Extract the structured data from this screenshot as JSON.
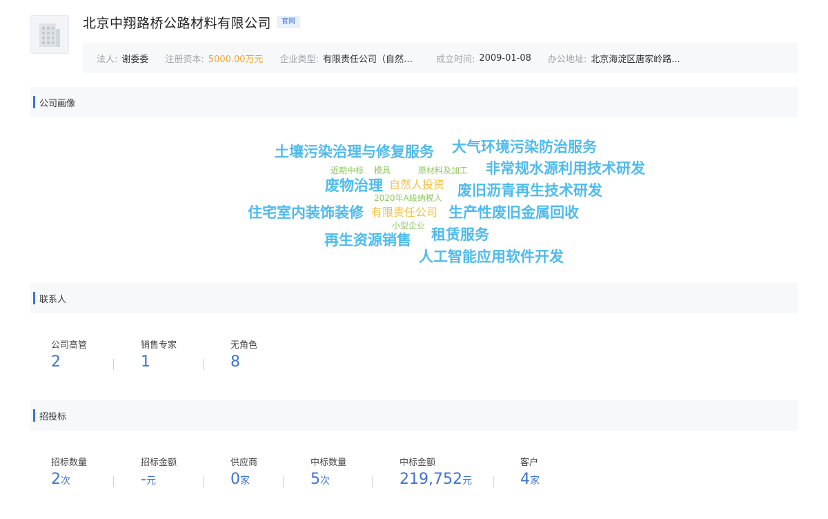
{
  "company": {
    "name": "北京中翔路桥公路材料有限公司",
    "official_tag": "官网",
    "logo_icon": "building-icon"
  },
  "info": [
    {
      "label": "法人:",
      "value": "谢委委",
      "color": "#333333"
    },
    {
      "label": "注册资本:",
      "value": "5000.00万元",
      "color": "#f5a623"
    },
    {
      "label": "企业类型:",
      "value": "有限责任公司（自然人投资或控股）"
    },
    {
      "label": "成立时间:",
      "value": "2009-01-08"
    },
    {
      "label": "办公地址:",
      "value": "北京海淀区唐家岭路..."
    }
  ],
  "sections": {
    "portrait": "公司画像",
    "contacts": "联系人",
    "bidding": "招投标"
  },
  "word_cloud": [
    "土壤污染治理与修复服务",
    "大气环境污染防治服务",
    "近期中标",
    "模具",
    "原材料及加工",
    "非常规水源利用技术研发",
    "废物治理",
    "自然人投资",
    "废旧沥青再生技术研发",
    "2020年A级纳税人",
    "住宅室内装饰装修",
    "有限责任公司",
    "生产性废旧金属回收",
    "小型企业",
    "再生资源销售",
    "租赁服务",
    "人工智能应用软件开发"
  ],
  "contacts": [
    {
      "label": "公司高管",
      "value": "2"
    },
    {
      "label": "销售专家",
      "value": "1"
    },
    {
      "label": "无角色",
      "value": "8"
    }
  ],
  "bidding": [
    {
      "label": "招标数量",
      "value": "2",
      "unit": "次"
    },
    {
      "label": "招标金额",
      "value": "-",
      "unit": "元"
    },
    {
      "label": "供应商",
      "value": "0",
      "unit": "家"
    },
    {
      "label": "中标数量",
      "value": "5",
      "unit": "次"
    },
    {
      "label": "中标金额",
      "value": "219,752",
      "unit": "元"
    },
    {
      "label": "客户",
      "value": "4",
      "unit": "家"
    }
  ],
  "colors": {
    "accent": "#3b73d8",
    "cloud_blue": "#4dbbee",
    "cloud_green": "#8fc75f",
    "cloud_orange": "#f6c146"
  }
}
